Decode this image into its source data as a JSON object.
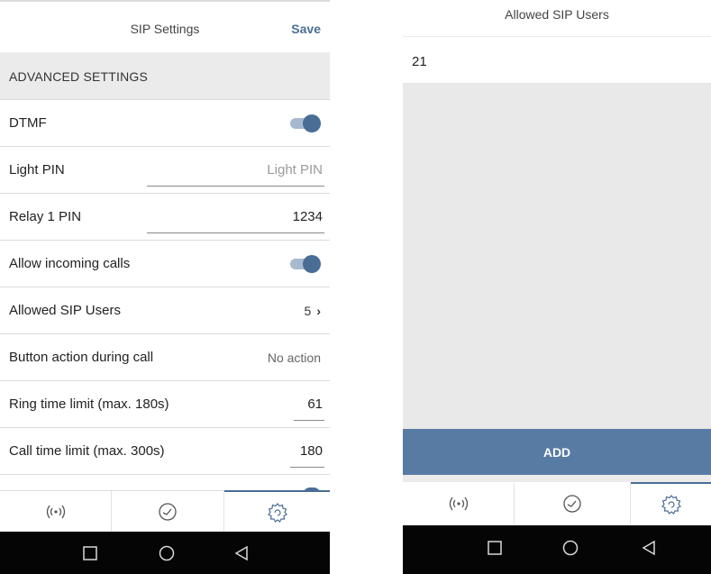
{
  "left_screen": {
    "header": {
      "title": "SIP Settings",
      "save_label": "Save"
    },
    "section_title": "ADVANCED SETTINGS",
    "rows": {
      "dtmf": {
        "label": "DTMF",
        "enabled": true
      },
      "light_pin": {
        "label": "Light PIN",
        "value": "",
        "placeholder": "Light PIN"
      },
      "relay1_pin": {
        "label": "Relay 1 PIN",
        "value": "1234"
      },
      "allow_incoming": {
        "label": "Allow incoming calls",
        "enabled": true
      },
      "allowed_sip_users": {
        "label": "Allowed SIP Users",
        "count": "5",
        "chevron": "›"
      },
      "button_action": {
        "label": "Button action during call",
        "value": "No action"
      },
      "ring_time": {
        "label": "Ring time limit (max. 180s)",
        "value": "61"
      },
      "call_time": {
        "label": "Call time limit (max. 300s)",
        "value": "180"
      }
    },
    "tabs": [
      {
        "icon": "broadcast-icon",
        "active": false
      },
      {
        "icon": "gauge-icon",
        "active": false
      },
      {
        "icon": "gear-icon",
        "active": true
      }
    ],
    "nav": [
      "recents-square-icon",
      "home-circle-icon",
      "back-triangle-icon"
    ]
  },
  "right_screen": {
    "header": {
      "title": "Allowed SIP Users"
    },
    "users": [
      "21"
    ],
    "add_label": "ADD",
    "tabs": [
      {
        "icon": "broadcast-icon",
        "active": false
      },
      {
        "icon": "gauge-icon",
        "active": false
      },
      {
        "icon": "gear-icon",
        "active": true
      }
    ]
  },
  "colors": {
    "accent": "#4a6d96",
    "add_button": "#587ba4",
    "toggle_track": "#a7b9cf",
    "section_bg": "#ebebeb",
    "navbar": "#050505"
  }
}
